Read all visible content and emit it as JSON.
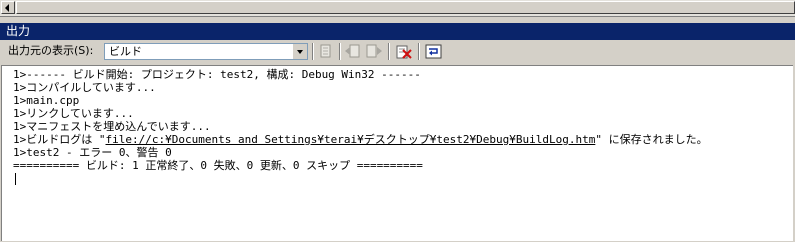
{
  "window": {
    "title": "出力"
  },
  "toolbar": {
    "source_label": "出力元の表示(S):",
    "source_value": "ビルド"
  },
  "icons": {
    "go_to_line": "document-goto-icon",
    "prev_message": "previous-message-icon",
    "next_message": "next-message-icon",
    "clear_all": "clear-all-icon",
    "word_wrap": "word-wrap-icon"
  },
  "output": {
    "lines": [
      "1>------ ビルド開始: プロジェクト: test2, 構成: Debug Win32 ------",
      "1>コンパイルしています...",
      "1>main.cpp",
      "1>リンクしています...",
      "1>マニフェストを埋め込んでいます...",
      "1>test2 - エラー 0、警告 0",
      "========== ビルド: 1 正常終了、0 失敗、0 更新、0 スキップ =========="
    ],
    "buildlog": {
      "prefix": "1>ビルドログは \"",
      "link": "file://c:¥Documents and Settings¥terai¥デスクトップ¥test2¥Debug¥BuildLog.htm",
      "suffix": "\" に保存されました。"
    }
  }
}
